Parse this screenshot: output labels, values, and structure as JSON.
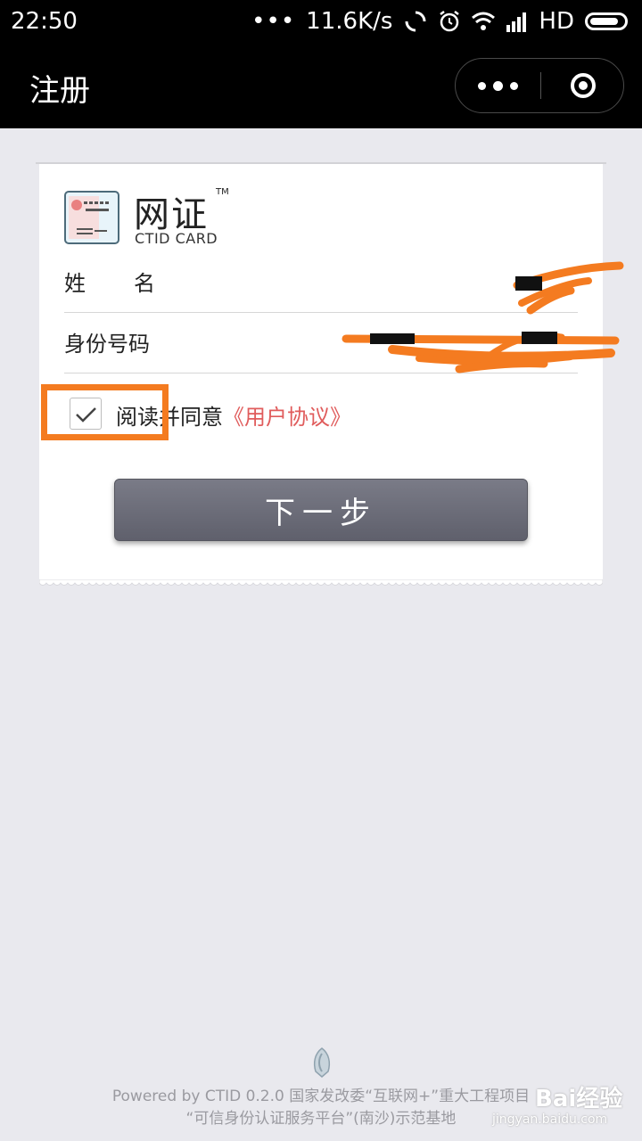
{
  "status_bar": {
    "time": "22:50",
    "dots": "•••",
    "speed": "11.6K/s",
    "network": "HD",
    "battery_level": 0.85
  },
  "nav": {
    "title": "注册"
  },
  "logo": {
    "title": "网证",
    "tm": "TM",
    "subtitle": "CTID CARD"
  },
  "form": {
    "name_label": "姓名",
    "name_value": "",
    "id_label": "身份号码",
    "id_value": "",
    "agree_checked": true,
    "agree_text": "阅读并同意",
    "agree_link": "《用户协议》"
  },
  "next_button": "下一步",
  "footer": {
    "line1": "Powered by CTID 0.2.0 国家发改委“互联网+”重大工程项目",
    "line2": "“可信身份认证服务平台”(南沙)示范基地"
  },
  "watermark": {
    "brand": "Bai经验",
    "url": "jingyan.baidu.com"
  },
  "colors": {
    "nav_bg": "#000000",
    "page_bg": "#e9e9ee",
    "link": "#e05c5c",
    "highlight": "#f47b20",
    "button": "#6b6c78"
  }
}
